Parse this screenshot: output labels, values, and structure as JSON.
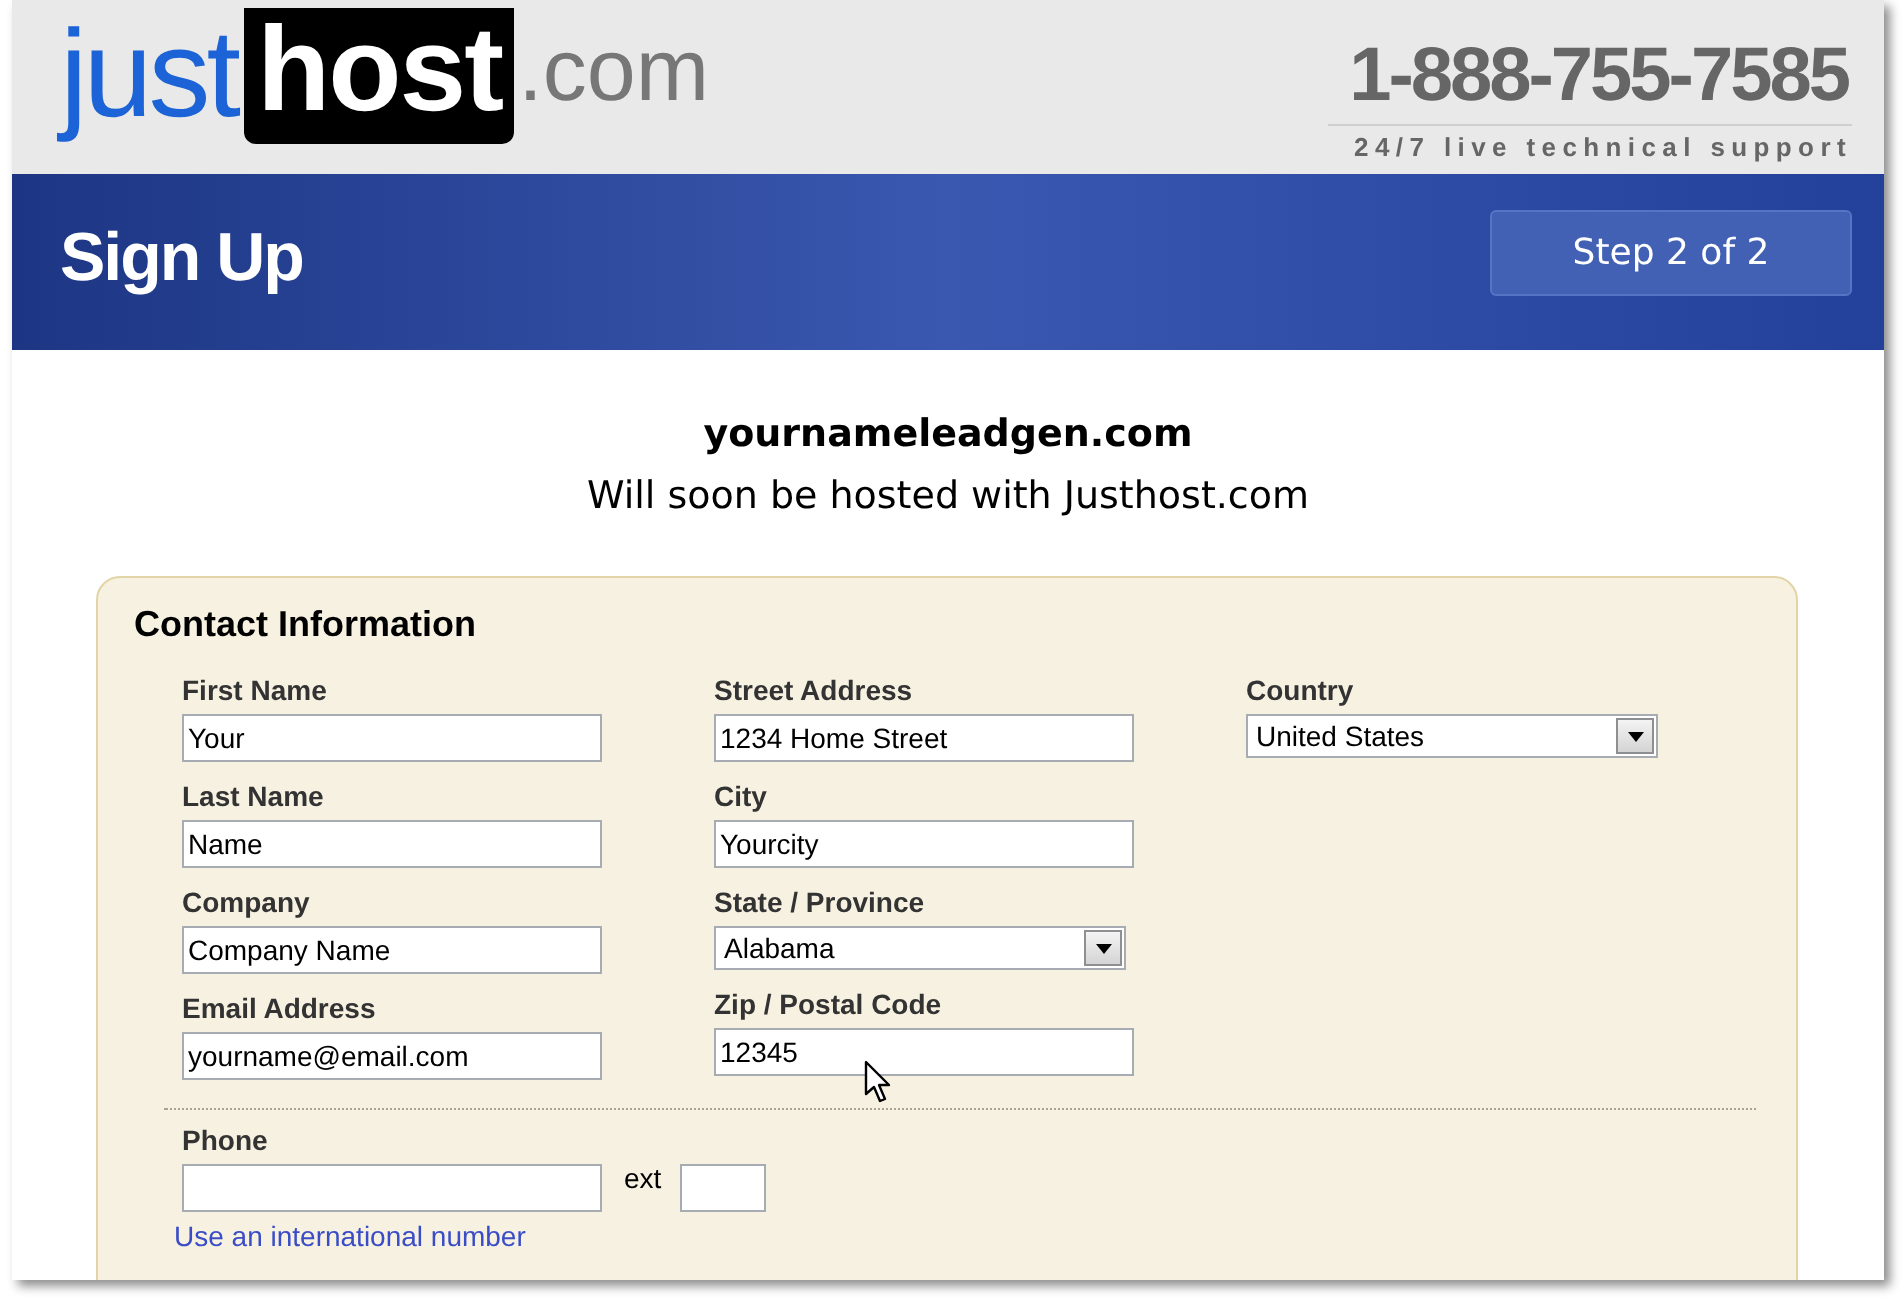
{
  "header": {
    "logo": {
      "part_1": "just",
      "part_2": "host",
      "part_3": ".com"
    },
    "phone": "1-888-755-7585",
    "tagline": "24/7 live technical support"
  },
  "banner": {
    "title": "Sign Up",
    "step": "Step 2 of 2"
  },
  "domain": {
    "name": "yournameleadgen.com",
    "subtitle": "Will soon be hosted with Justhost.com"
  },
  "contact_form": {
    "title": "Contact Information",
    "columns": [
      [
        {
          "kind": "text",
          "label": "First Name",
          "value": "Your"
        },
        {
          "kind": "text",
          "label": "Last Name",
          "value": "Name"
        },
        {
          "kind": "text",
          "label": "Company",
          "value": "Company Name"
        },
        {
          "kind": "text",
          "label": "Email Address",
          "value": "yourname@email.com"
        }
      ],
      [
        {
          "kind": "text",
          "label": "Street Address",
          "value": "1234 Home Street"
        },
        {
          "kind": "text",
          "label": "City",
          "value": "Yourcity"
        },
        {
          "kind": "select",
          "label": "State / Province",
          "value": "Alabama"
        },
        {
          "kind": "text",
          "label": "Zip / Postal Code",
          "value": "12345"
        }
      ],
      [
        {
          "kind": "select",
          "label": "Country",
          "value": "United States"
        }
      ]
    ],
    "phone": {
      "label": "Phone",
      "ext_label": "ext"
    },
    "link": "Use an international number"
  }
}
